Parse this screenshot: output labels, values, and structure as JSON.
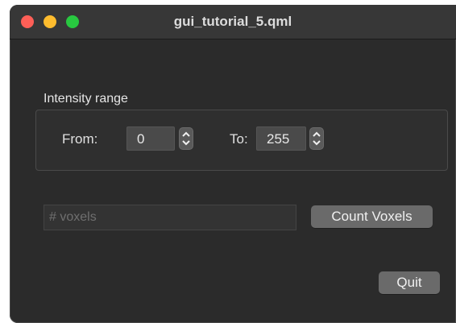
{
  "window": {
    "title": "gui_tutorial_5.qml"
  },
  "intensity": {
    "label": "Intensity range",
    "from_label": "From:",
    "from_value": "0",
    "to_label": "To:",
    "to_value": "255"
  },
  "voxels": {
    "placeholder": "# voxels"
  },
  "buttons": {
    "count": "Count Voxels",
    "quit": "Quit"
  }
}
